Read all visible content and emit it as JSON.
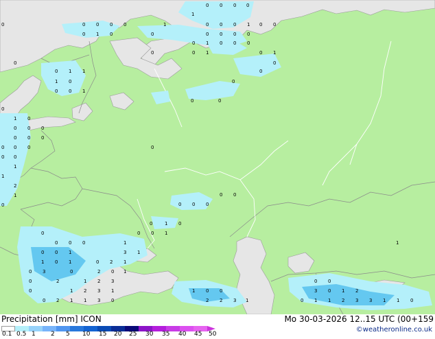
{
  "map": {
    "land_color": "#b7eea0",
    "sea_color": "#e6e6e6",
    "rain_light": "#b4f0fa",
    "rain_medium": "#64c8f0",
    "values": [
      {
        "t": "1"
      },
      {
        "t": "0"
      },
      {
        "t": "0"
      },
      {
        "t": "0"
      },
      {
        "t": "0"
      },
      {
        "t": "0"
      },
      {
        "t": "0"
      },
      {
        "t": "0"
      },
      {
        "t": "0"
      },
      {
        "t": "1"
      },
      {
        "t": "0"
      },
      {
        "t": "0"
      },
      {
        "t": "0"
      },
      {
        "t": "1"
      },
      {
        "t": "0"
      },
      {
        "t": "0"
      },
      {
        "t": "0"
      },
      {
        "t": "0"
      },
      {
        "t": "1"
      },
      {
        "t": "0"
      },
      {
        "t": "0"
      },
      {
        "t": "0"
      },
      {
        "t": "0"
      },
      {
        "t": "0"
      },
      {
        "t": "0"
      },
      {
        "t": "0"
      },
      {
        "t": "1"
      },
      {
        "t": "0"
      },
      {
        "t": "0"
      },
      {
        "t": "0"
      },
      {
        "t": "0"
      },
      {
        "t": "0"
      },
      {
        "t": "1"
      },
      {
        "t": "0"
      },
      {
        "t": "1"
      },
      {
        "t": "0"
      },
      {
        "t": "0"
      },
      {
        "t": "0"
      },
      {
        "t": "1"
      },
      {
        "t": "1"
      },
      {
        "t": "0"
      },
      {
        "t": "1"
      },
      {
        "t": "0"
      },
      {
        "t": "0"
      },
      {
        "t": "0"
      },
      {
        "t": "0"
      },
      {
        "t": "1"
      },
      {
        "t": "0"
      },
      {
        "t": "0"
      },
      {
        "t": "0"
      },
      {
        "t": "1"
      },
      {
        "t": "0"
      },
      {
        "t": "0"
      },
      {
        "t": "0"
      },
      {
        "t": "0"
      },
      {
        "t": "0"
      },
      {
        "t": "0"
      },
      {
        "t": "0"
      },
      {
        "t": "0"
      },
      {
        "t": "0"
      },
      {
        "t": "0"
      },
      {
        "t": "0"
      },
      {
        "t": "0"
      },
      {
        "t": "1"
      },
      {
        "t": "1"
      },
      {
        "t": "2"
      },
      {
        "t": "1"
      },
      {
        "t": "0"
      },
      {
        "t": "0"
      },
      {
        "t": "0"
      },
      {
        "t": "0"
      },
      {
        "t": "0"
      },
      {
        "t": "0"
      },
      {
        "t": "0"
      },
      {
        "t": "0"
      },
      {
        "t": "1"
      },
      {
        "t": "0"
      },
      {
        "t": "0"
      },
      {
        "t": "0"
      },
      {
        "t": "0"
      },
      {
        "t": "0"
      },
      {
        "t": "0"
      },
      {
        "t": "1"
      },
      {
        "t": "0"
      },
      {
        "t": "1"
      },
      {
        "t": "0"
      },
      {
        "t": "0"
      },
      {
        "t": "1"
      },
      {
        "t": "3"
      },
      {
        "t": "1"
      },
      {
        "t": "1"
      },
      {
        "t": "0"
      },
      {
        "t": "1"
      },
      {
        "t": "0"
      },
      {
        "t": "2"
      },
      {
        "t": "1"
      },
      {
        "t": "0"
      },
      {
        "t": "3"
      },
      {
        "t": "0"
      },
      {
        "t": "2"
      },
      {
        "t": "0"
      },
      {
        "t": "1"
      },
      {
        "t": "0"
      },
      {
        "t": "2"
      },
      {
        "t": "1"
      },
      {
        "t": "2"
      },
      {
        "t": "3"
      },
      {
        "t": "0"
      },
      {
        "t": "1"
      },
      {
        "t": "2"
      },
      {
        "t": "3"
      },
      {
        "t": "1"
      },
      {
        "t": "0"
      },
      {
        "t": "2"
      },
      {
        "t": "1"
      },
      {
        "t": "1"
      },
      {
        "t": "3"
      },
      {
        "t": "0"
      },
      {
        "t": "1"
      },
      {
        "t": "0"
      },
      {
        "t": "0"
      },
      {
        "t": "2"
      },
      {
        "t": "2"
      },
      {
        "t": "3"
      },
      {
        "t": "1"
      },
      {
        "t": "1"
      },
      {
        "t": "0"
      },
      {
        "t": "0"
      },
      {
        "t": "3"
      },
      {
        "t": "0"
      },
      {
        "t": "1"
      },
      {
        "t": "2"
      },
      {
        "t": "0"
      },
      {
        "t": "1"
      },
      {
        "t": "1"
      },
      {
        "t": "2"
      },
      {
        "t": "3"
      },
      {
        "t": "3"
      },
      {
        "t": "1"
      },
      {
        "t": "1"
      },
      {
        "t": "0"
      }
    ]
  },
  "legend": {
    "title": "Precipitation [mm]  ICON",
    "datetime": "Mo 30-03-2026 12..15 UTC (00+159",
    "credit": "©weatheronline.co.uk",
    "colors": [
      "#ffffff",
      "#b4f0fa",
      "#96d2fa",
      "#78b4fa",
      "#5096f0",
      "#2878dc",
      "#1464d2",
      "#0a4bb4",
      "#0a2d96",
      "#0a0a78",
      "#8c14c8",
      "#b41edc",
      "#c83ce6",
      "#dc50f0",
      "#e664f0"
    ],
    "ticks": [
      "0.1",
      "0.5",
      "1",
      "2",
      "5",
      "10",
      "15",
      "20",
      "25",
      "30",
      "35",
      "40",
      "45",
      "50"
    ]
  }
}
